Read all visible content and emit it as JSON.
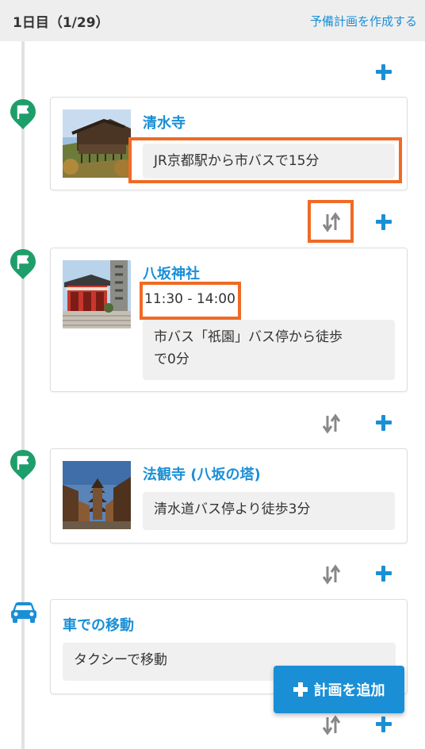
{
  "header": {
    "day_title": "1日目（1/29）",
    "backup_plan_link": "予備計画を作成する"
  },
  "items": [
    {
      "name": "清水寺",
      "note": "JR京都駅から市バスで15分"
    },
    {
      "name": "八坂神社",
      "time": "11:30 - 14:00",
      "note_line1": "市バス「祇園」バス停から徒歩",
      "note_line2": "で0分"
    },
    {
      "name": "法観寺 (八坂の塔)",
      "note": "清水道バス停より徒歩3分"
    },
    {
      "name": "車での移動",
      "note": "タクシーで移動"
    }
  ],
  "add_plan_button": "計画を追加",
  "colors": {
    "accent": "#1a8fd6",
    "pin": "#1e9e6a",
    "highlight": "#f06a25"
  },
  "icons": [
    "flag-pin-icon",
    "car-icon",
    "swap-order-icon",
    "plus-icon"
  ]
}
